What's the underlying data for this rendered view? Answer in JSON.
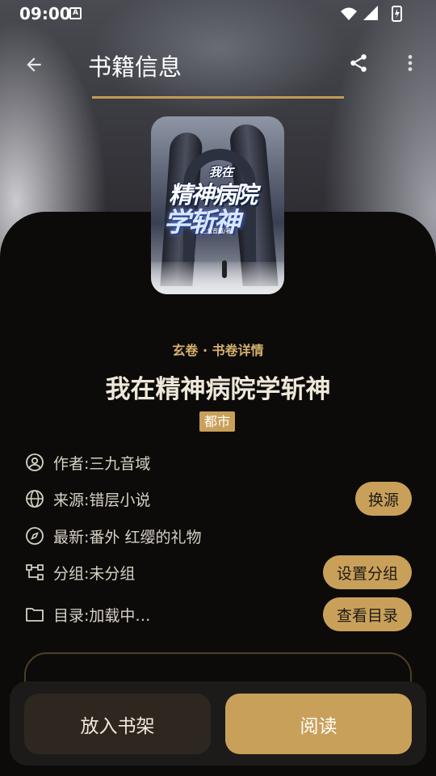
{
  "status_bar": {
    "time": "09:00",
    "indicator": "A"
  },
  "app_bar": {
    "title": "书籍信息"
  },
  "cover": {
    "line1": "我在",
    "line2": "精神病院",
    "line3": "学斩神",
    "author": "三九音域/著"
  },
  "book": {
    "category": "玄卷 · 书卷详情",
    "name": "我在精神病院学斩神",
    "tag": "都市"
  },
  "info": {
    "author_label": "作者:",
    "author": "三九音域",
    "source_label": "来源:",
    "source": "错层小说",
    "latest_label": "最新:",
    "latest": "番外 红缨的礼物",
    "group_label": "分组:",
    "group": "未分组",
    "toc_label": "目录:",
    "toc": "加载中…"
  },
  "buttons": {
    "change_source": "换源",
    "set_group": "设置分组",
    "view_toc": "查看目录",
    "add_shelf": "放入书架",
    "read": "阅读"
  },
  "colors": {
    "accent": "#c9a05a",
    "background": "#0c0b0a"
  }
}
